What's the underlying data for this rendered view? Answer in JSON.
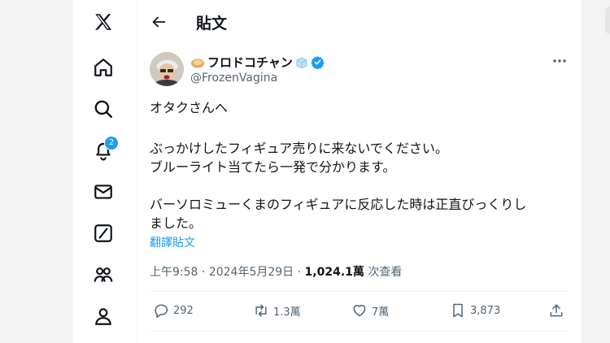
{
  "header": {
    "title": "貼文"
  },
  "author": {
    "display_name": "フロドコチャン",
    "handle": "@FrozenVagina"
  },
  "post": {
    "line1": "オタクさんへ",
    "line2": "ぶっかけしたフィギュア売りに来ないでください。",
    "line3": "ブルーライト当てたら一発で分かります。",
    "line4": "バーソロミューくまのフィギュアに反応した時は正直びっくりし",
    "line5": "ました。",
    "translate_label": "翻譯貼文"
  },
  "meta": {
    "time": "上午9:58",
    "sep1": " · ",
    "date": "2024年5月29日",
    "sep2": " · ",
    "views": "1,024.1萬",
    "views_label": " 次查看"
  },
  "actions": {
    "replies": "292",
    "reposts": "1.3萬",
    "likes": "7萬",
    "bookmarks": "3,873"
  },
  "sidebar": {
    "notification_count": "2"
  },
  "colors": {
    "accent": "#1d9bf0",
    "text": "#0f1419",
    "muted": "#536471"
  }
}
